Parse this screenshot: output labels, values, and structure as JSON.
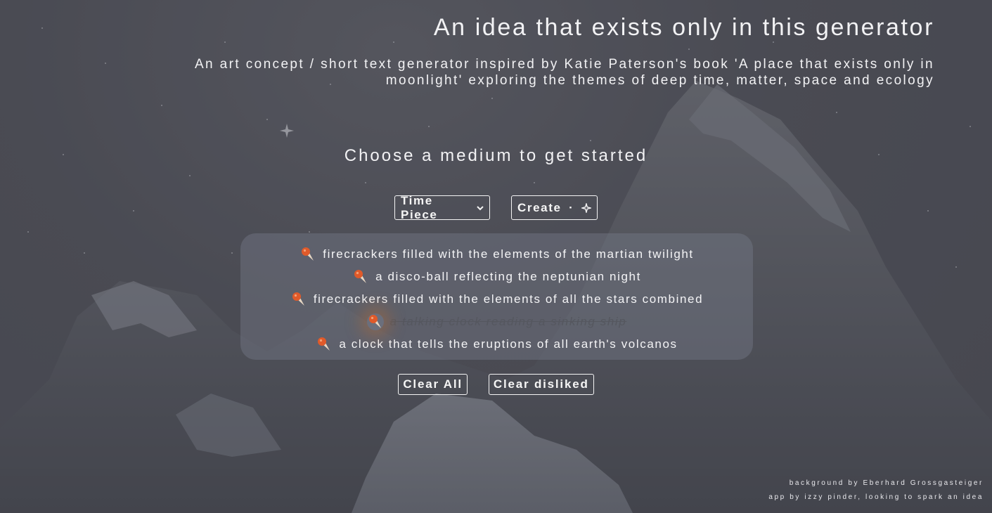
{
  "header": {
    "title": "An idea that exists only in this generator",
    "subtitle": "An art concept / short text generator inspired by Katie Paterson's book 'A place that exists only in moonlight' exploring the themes of deep time, matter, space and ecology"
  },
  "prompt": "Choose a medium to get started",
  "controls": {
    "medium_select": "Time Piece",
    "create_label": "Create",
    "create_separator": "·",
    "create_icon": "sparkle-icon"
  },
  "ideas": [
    {
      "text": "firecrackers filled with the elements of the martian twilight",
      "disliked": false,
      "icon": "ice-cream-icon"
    },
    {
      "text": "a disco-ball reflecting the neptunian night",
      "disliked": false,
      "icon": "ice-cream-icon"
    },
    {
      "text": "firecrackers filled with the elements of all the stars combined",
      "disliked": false,
      "icon": "ice-cream-icon"
    },
    {
      "text": "a talking clock reading a sinking ship",
      "disliked": true,
      "icon": "ice-cream-icon"
    },
    {
      "text": "a clock that tells the eruptions of all earth's volcanos",
      "disliked": false,
      "icon": "ice-cream-icon"
    }
  ],
  "actions": {
    "clear_all": "Clear All",
    "clear_disliked": "Clear disliked"
  },
  "footer": {
    "credit_background": "background by Eberhard Grossgasteiger",
    "credit_app": "app by izzy pinder, looking to spark an idea"
  },
  "colors": {
    "text": "#f2f2f4",
    "panel": "#787c8a",
    "cone": "#e8d8c4",
    "scoop": "#e05a2a"
  }
}
